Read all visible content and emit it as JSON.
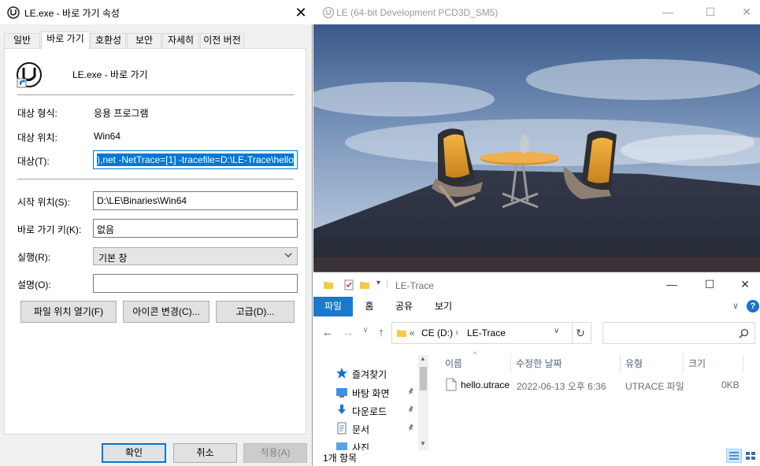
{
  "dialog": {
    "title": "LE.exe - 바로 가기 속성",
    "tabs": [
      "일반",
      "바로 가기",
      "호환성",
      "보안",
      "자세히",
      "이전 버전"
    ],
    "active_tab": "바로 가기",
    "shortcut_name": "LE.exe - 바로 가기",
    "target_type_label": "대상 형식:",
    "target_type_value": "응용 프로그램",
    "target_location_label": "대상 위치:",
    "target_location_value": "Win64",
    "target_label": "대상(T):",
    "target_value": "),net -NetTrace=[1] -tracefile=D:\\LE-Trace\\hello",
    "start_in_label": "시작 위치(S):",
    "start_in_value": "D:\\LE\\Binaries\\Win64",
    "hotkey_label": "바로 가기 키(K):",
    "hotkey_value": "없음",
    "run_label": "실행(R):",
    "run_value": "기본 창",
    "comment_label": "설명(O):",
    "comment_value": "",
    "open_location_button": "파일 위치 열기(F)",
    "change_icon_button": "아이콘 변경(C)...",
    "advanced_button": "고급(D)...",
    "ok_button": "확인",
    "cancel_button": "취소",
    "apply_button": "적용(A)"
  },
  "game_window": {
    "title": "LE (64-bit Development PCD3D_SM5)"
  },
  "explorer": {
    "title": "LE-Trace",
    "ribbon_tabs": [
      "파일",
      "홈",
      "공유",
      "보기"
    ],
    "breadcrumb": [
      "«",
      "CE (D:)",
      "LE-Trace"
    ],
    "search_placeholder": "",
    "nav_items": [
      {
        "label": "즐겨찾기",
        "icon": "star-icon"
      },
      {
        "label": "바탕 화면",
        "icon": "desktop-icon"
      },
      {
        "label": "다운로드",
        "icon": "download-icon"
      },
      {
        "label": "문서",
        "icon": "document-icon"
      },
      {
        "label": "사진",
        "icon": "picture-icon"
      }
    ],
    "columns": [
      "이름",
      "수정한 날짜",
      "유형",
      "크기"
    ],
    "files": [
      {
        "name": "hello.utrace",
        "modified": "2022-06-13 오후 6:36",
        "type": "UTRACE 파일",
        "size": "0KB"
      }
    ],
    "status": "1개 항목"
  },
  "colors": {
    "selection": "#0078d7",
    "ribbon_file_tab": "#1979ca",
    "dialog_bg": "#f0f0f0"
  }
}
